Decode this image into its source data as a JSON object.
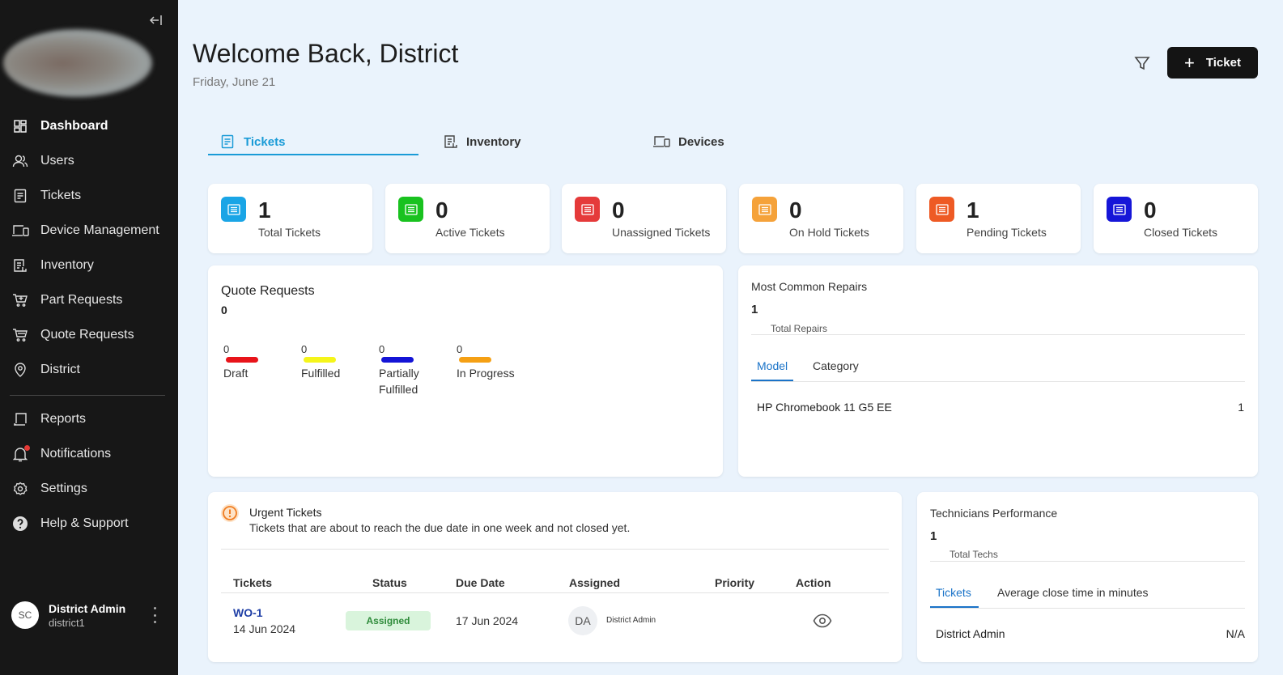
{
  "sidebar": {
    "collapse_icon": "collapse-left-icon",
    "items": [
      {
        "label": "Dashboard",
        "icon": "dashboard-icon"
      },
      {
        "label": "Users",
        "icon": "users-icon"
      },
      {
        "label": "Tickets",
        "icon": "ticket-icon"
      },
      {
        "label": "Device Management",
        "icon": "devices-icon"
      },
      {
        "label": "Inventory",
        "icon": "inventory-icon"
      },
      {
        "label": "Part Requests",
        "icon": "cart-plus-icon"
      },
      {
        "label": "Quote Requests",
        "icon": "cart-icon"
      },
      {
        "label": "District",
        "icon": "location-icon"
      }
    ],
    "secondary": [
      {
        "label": "Reports",
        "icon": "reports-icon"
      },
      {
        "label": "Notifications",
        "icon": "bell-icon"
      },
      {
        "label": "Settings",
        "icon": "gear-icon"
      },
      {
        "label": "Help & Support",
        "icon": "help-icon"
      }
    ],
    "user": {
      "initials": "SC",
      "name": "District Admin",
      "username": "district1"
    }
  },
  "header": {
    "title": "Welcome Back, District",
    "date": "Friday, June 21",
    "new_ticket_label": "Ticket"
  },
  "tabs": [
    {
      "label": "Tickets",
      "icon": "ticket-icon"
    },
    {
      "label": "Inventory",
      "icon": "inventory-icon"
    },
    {
      "label": "Devices",
      "icon": "devices-icon"
    }
  ],
  "stats": [
    {
      "value": "1",
      "label": "Total Tickets",
      "color": "#1aa5e6"
    },
    {
      "value": "0",
      "label": "Active Tickets",
      "color": "#19c21f"
    },
    {
      "value": "0",
      "label": "Unassigned Tickets",
      "color": "#e53a3a"
    },
    {
      "value": "0",
      "label": "On Hold Tickets",
      "color": "#f5a23a"
    },
    {
      "value": "1",
      "label": "Pending Tickets",
      "color": "#ee5a24"
    },
    {
      "value": "0",
      "label": "Closed Tickets",
      "color": "#1616d8"
    }
  ],
  "quote_requests": {
    "title": "Quote Requests",
    "count": "0",
    "legend": [
      {
        "value": "0",
        "label": "Draft",
        "color": "#e8141a"
      },
      {
        "value": "0",
        "label": "Fulfilled",
        "color": "#f5f51a"
      },
      {
        "value": "0",
        "label": "Partially Fulfilled",
        "color": "#1414d6"
      },
      {
        "value": "0",
        "label": "In Progress",
        "color": "#f5a014"
      }
    ]
  },
  "repairs": {
    "title": "Most Common Repairs",
    "count": "1",
    "sub": "Total Repairs",
    "tabs": [
      "Model",
      "Category"
    ],
    "rows": [
      {
        "name": "HP Chromebook 11 G5 EE",
        "value": "1"
      }
    ]
  },
  "urgent": {
    "title": "Urgent Tickets",
    "description": "Tickets that are about to reach the due date in one week and not closed yet.",
    "columns": [
      "Tickets",
      "Status",
      "Due Date",
      "Assigned",
      "Priority",
      "Action"
    ],
    "rows": [
      {
        "id": "WO-1",
        "created": "14 Jun 2024",
        "status": "Assigned",
        "due": "17 Jun 2024",
        "assigned_initials": "DA",
        "assigned_name": "District Admin",
        "priority": ""
      }
    ]
  },
  "techs": {
    "title": "Technicians Performance",
    "count": "1",
    "sub": "Total Techs",
    "tabs": [
      "Tickets",
      "Average close time in minutes"
    ],
    "rows": [
      {
        "name": "District Admin",
        "value": "N/A"
      }
    ]
  }
}
